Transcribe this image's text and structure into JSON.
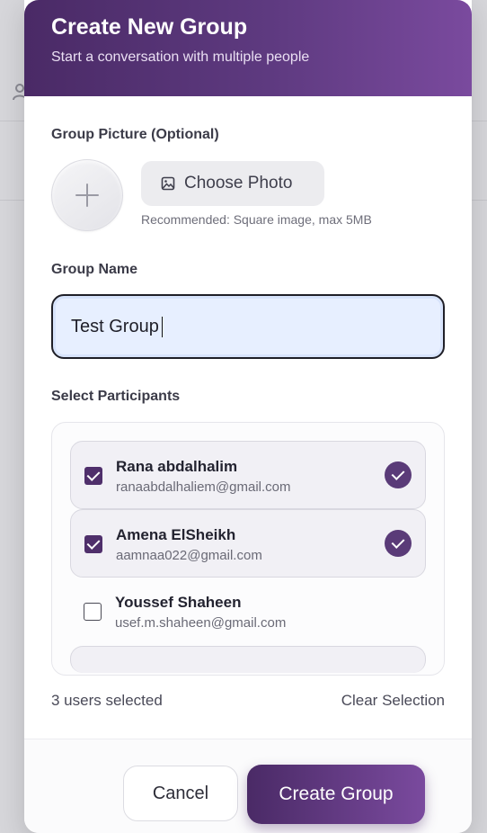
{
  "modal": {
    "title": "Create New Group",
    "subtitle": "Start a conversation with multiple people"
  },
  "group_picture": {
    "label": "Group Picture (Optional)",
    "choose_photo_label": "Choose Photo",
    "hint": "Recommended: Square image, max 5MB"
  },
  "group_name": {
    "label": "Group Name",
    "value": "Test Group"
  },
  "participants": {
    "label": "Select Participants",
    "items": [
      {
        "name": "Rana abdalhalim",
        "email": "ranaabdalhaliem@gmail.com",
        "selected": true
      },
      {
        "name": "Amena ElSheikh",
        "email": "aamnaa022@gmail.com",
        "selected": true
      },
      {
        "name": "Youssef Shaheen",
        "email": "usef.m.shaheen@gmail.com",
        "selected": false
      }
    ],
    "selected_count_text": "3 users selected",
    "clear_selection_label": "Clear Selection"
  },
  "footer": {
    "cancel_label": "Cancel",
    "create_label": "Create Group"
  },
  "colors": {
    "accent_dark": "#4a2a66",
    "accent_light": "#7a4a9e",
    "input_bg": "#e7efff"
  }
}
